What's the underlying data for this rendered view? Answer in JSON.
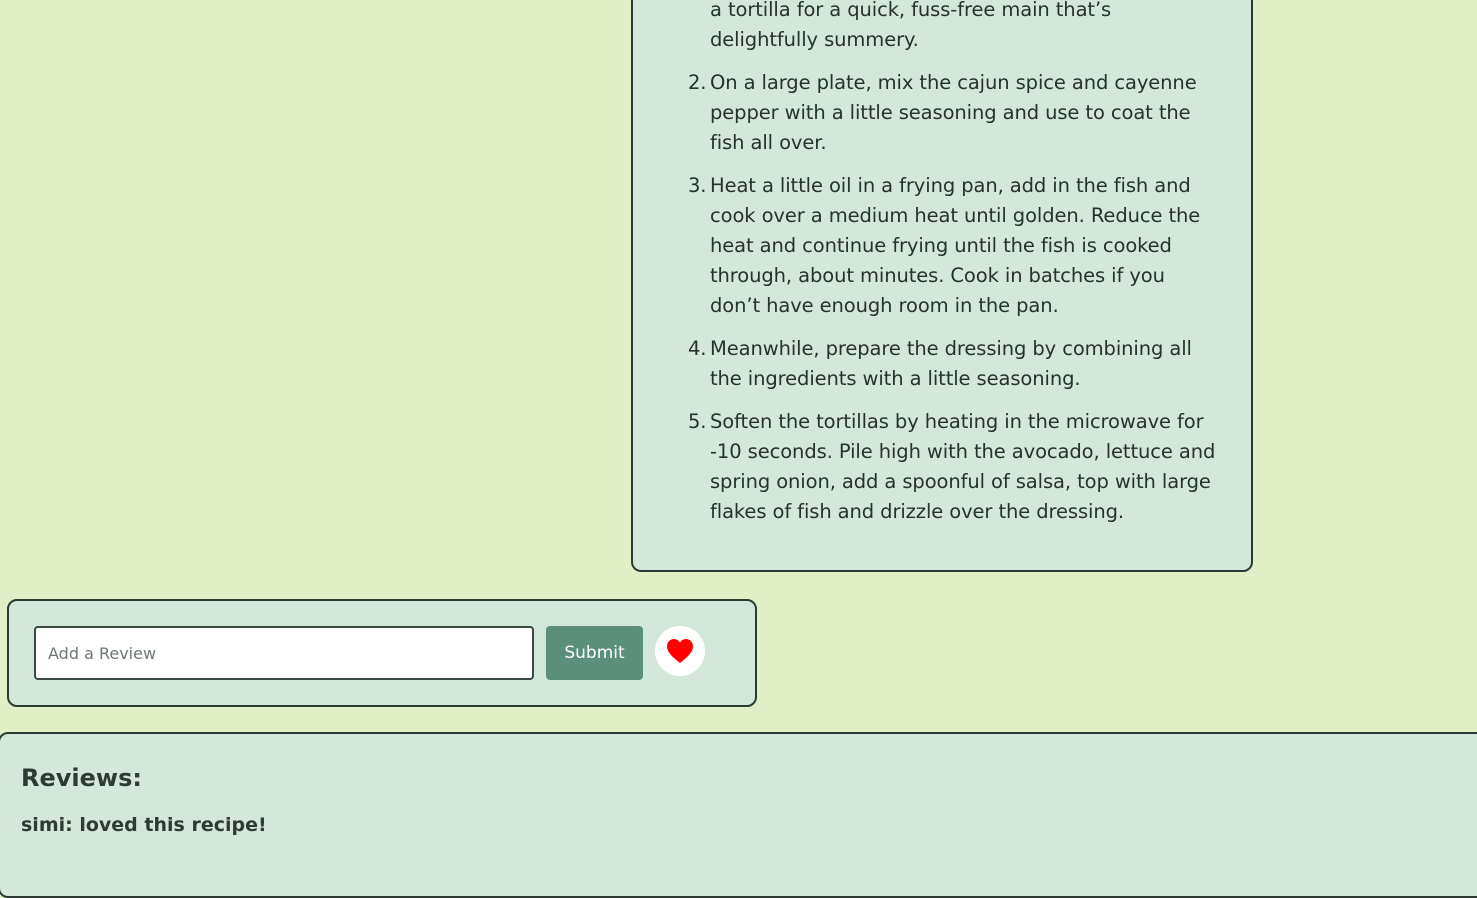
{
  "method": {
    "steps": [
      {
        "number": "",
        "lines": [
          "a tortilla for a quick, fuss-free main that’s",
          "delightfully summery."
        ]
      },
      {
        "number": "2.",
        "lines": [
          "On a large plate, mix the cajun spice and cayenne",
          "pepper with a little seasoning and use to coat the",
          "fish all over."
        ]
      },
      {
        "number": "3.",
        "lines": [
          "Heat a little oil in a frying pan, add in the fish and",
          "cook over a medium heat until golden. Reduce the",
          "heat and continue frying until the fish is cooked",
          "through, about minutes. Cook in batches if you",
          "don’t have enough room in the pan."
        ]
      },
      {
        "number": "4.",
        "lines": [
          "Meanwhile, prepare the dressing by combining all",
          "the ingredients with a little seasoning."
        ]
      },
      {
        "number": "5.",
        "lines": [
          "Soften the tortillas by heating in the microwave for",
          "-10 seconds. Pile high with the avocado, lettuce and",
          "spring onion, add a spoonful of salsa, top with large",
          "flakes of fish and drizzle over the dressing."
        ]
      }
    ]
  },
  "review_form": {
    "input_value": "",
    "input_placeholder": "Add a Review",
    "submit_label": "Submit",
    "favorite_icon": "heart-icon",
    "favorite_color": "#ff0000"
  },
  "reviews": {
    "heading": "Reviews:",
    "items": [
      {
        "text": "simi: loved this recipe!"
      }
    ]
  },
  "colors": {
    "page_background": "#e1efc7",
    "card_background": "#d3e8da",
    "border": "#2c3a33",
    "button": "#5a8f7b"
  }
}
